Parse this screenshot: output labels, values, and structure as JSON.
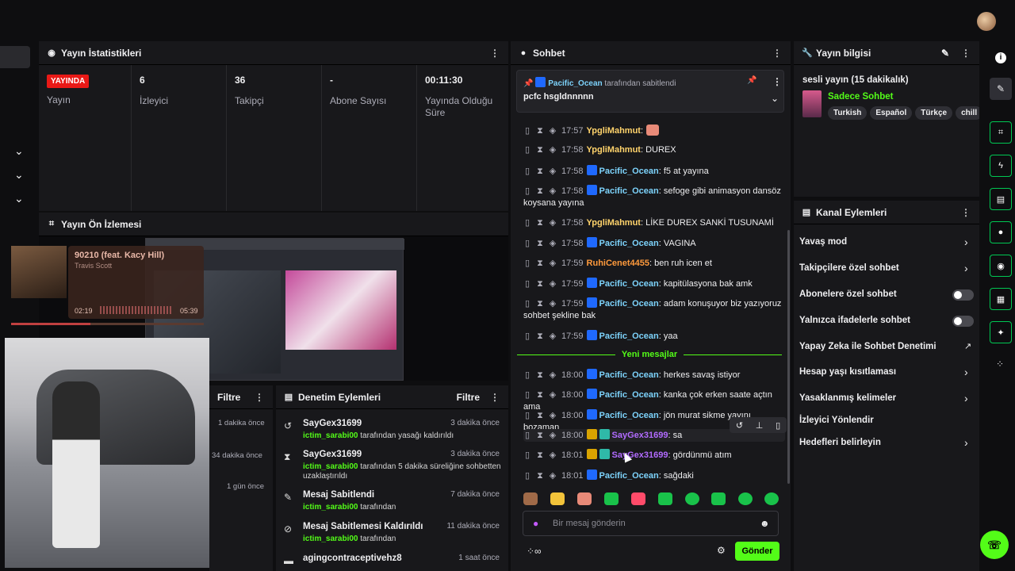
{
  "stats_panel": {
    "title": "Yayın İstatistikleri",
    "live_badge": "YAYINDA",
    "items": [
      {
        "value": "",
        "label": "Yayın"
      },
      {
        "value": "6",
        "label": "İzleyici"
      },
      {
        "value": "36",
        "label": "Takipçi"
      },
      {
        "value": "-",
        "label": "Abone Sayısı"
      },
      {
        "value": "00:11:30",
        "label": "Yayında Olduğu Süre"
      }
    ]
  },
  "preview_panel": {
    "title": "Yayın Ön İzlemesi"
  },
  "music": {
    "title": "90210 (feat. Kacy Hill)",
    "artist": "Travis Scott",
    "elapsed": "02:19",
    "duration": "05:39"
  },
  "left_panel": {
    "filter_label": "Filtre",
    "times": [
      "1 dakika önce",
      "34 dakika önce",
      "1 gün önce"
    ]
  },
  "mod_panel": {
    "title": "Denetim Eylemleri",
    "filter_label": "Filtre",
    "items": [
      {
        "icon": "undo-icon",
        "name": "SayGex31699",
        "time": "3 dakika önce",
        "actor": "ictim_sarabi00",
        "desc": " tarafından yasağı kaldırıldı"
      },
      {
        "icon": "hourglass-icon",
        "name": "SayGex31699",
        "time": "3 dakika önce",
        "actor": "ictim_sarabi00",
        "desc": " tarafından 5 dakika süreliğine sohbetten uzaklaştırıldı"
      },
      {
        "icon": "pin-icon",
        "name": "Mesaj Sabitlendi",
        "time": "7 dakika önce",
        "actor": "ictim_sarabi00",
        "desc": " tarafından"
      },
      {
        "icon": "unpin-icon",
        "name": "Mesaj Sabitlemesi Kaldırıldı",
        "time": "11 dakika önce",
        "actor": "ictim_sarabi00",
        "desc": " tarafından"
      },
      {
        "icon": "chat-icon",
        "name": "agingcontraceptivehz8",
        "time": "1 saat önce",
        "actor": "",
        "desc": ""
      }
    ]
  },
  "chat": {
    "title": "Sohbet",
    "pinned_by_user": "Pacific_Ocean",
    "pinned_by_suffix": "tarafından sabitlendi",
    "pinned_text": "pcfc hsgldnnnnn",
    "new_messages_label": "Yeni mesajlar",
    "messages": [
      {
        "time": "17:57",
        "user": "YpgliMahmut",
        "text": ":",
        "color": "u-yel",
        "badges": []
      },
      {
        "time": "17:58",
        "user": "YpgliMahmut",
        "text": ": DUREX",
        "color": "u-yel",
        "badges": []
      },
      {
        "time": "17:58",
        "user": "Pacific_Ocean",
        "text": ": f5 at yayına",
        "color": "u-blue",
        "badges": [
          "blue"
        ]
      },
      {
        "time": "17:58",
        "user": "Pacific_Ocean",
        "text": ": sefoge gibi animasyon dansöz koysana yayına",
        "color": "u-blue",
        "badges": [
          "blue"
        ]
      },
      {
        "time": "17:58",
        "user": "YpgliMahmut",
        "text": ": LİKE DUREX SANKİ TUSUNAMİ",
        "color": "u-yel",
        "badges": []
      },
      {
        "time": "17:58",
        "user": "Pacific_Ocean",
        "text": ": VAGINA",
        "color": "u-blue",
        "badges": [
          "blue"
        ]
      },
      {
        "time": "17:59",
        "user": "RuhiCenet4455",
        "text": ": ben ruh icen et",
        "color": "u-org",
        "badges": []
      },
      {
        "time": "17:59",
        "user": "Pacific_Ocean",
        "text": ": kapitülasyona bak amk",
        "color": "u-blue",
        "badges": [
          "blue"
        ]
      },
      {
        "time": "17:59",
        "user": "Pacific_Ocean",
        "text": ": adam konuşuyor biz yazıyoruz sohbet şekline bak",
        "color": "u-blue",
        "badges": [
          "blue"
        ]
      },
      {
        "time": "17:59",
        "user": "Pacific_Ocean",
        "text": ": yaa",
        "color": "u-blue",
        "badges": [
          "blue"
        ]
      },
      {
        "time": "18:00",
        "user": "Pacific_Ocean",
        "text": ": herkes savaş istiyor",
        "color": "u-blue",
        "badges": [
          "blue"
        ]
      },
      {
        "time": "18:00",
        "user": "Pacific_Ocean",
        "text": ": kanka çok erken saate açtın ama",
        "color": "u-blue",
        "badges": [
          "blue"
        ]
      },
      {
        "time": "18:00",
        "user": "Pacific_Ocean",
        "text": ": jön murat sikme yayını bozaman",
        "color": "u-blue",
        "badges": [
          "blue"
        ]
      },
      {
        "time": "18:00",
        "user": "SayGex31699",
        "text": ": sa",
        "color": "u-pur",
        "badges": [
          "gold",
          "teal"
        ]
      },
      {
        "time": "18:01",
        "user": "SayGex31699",
        "text": ": gördünmü atım",
        "color": "u-pur",
        "badges": [
          "gold",
          "teal"
        ]
      },
      {
        "time": "18:01",
        "user": "Pacific_Ocean",
        "text": ": sağdaki",
        "color": "u-blue",
        "badges": [
          "blue"
        ]
      }
    ],
    "input_placeholder": "Bir mesaj gönderin",
    "send_label": "Gönder"
  },
  "stream_info": {
    "title": "Yayın bilgisi",
    "stream_title": "sesli yayın (15 dakikalık)",
    "category": "Sadece Sohbet",
    "tags": [
      "Turkish",
      "Español",
      "Türkçe",
      "chill"
    ]
  },
  "channel_actions": {
    "title": "Kanal Eylemleri",
    "items": [
      {
        "label": "Yavaş mod",
        "control": "arrow"
      },
      {
        "label": "Takipçilere özel sohbet",
        "control": "arrow"
      },
      {
        "label": "Abonelere özel sohbet",
        "control": "toggle"
      },
      {
        "label": "Yalnızca ifadelerle sohbet",
        "control": "toggle"
      },
      {
        "label": "Yapay Zeka ile Sohbet Denetimi",
        "control": "external"
      },
      {
        "label": "Hesap yaşı kısıtlaması",
        "control": "arrow"
      },
      {
        "label": "Yasaklanmış kelimeler",
        "control": "arrow"
      },
      {
        "label": "İzleyici Yönlendir",
        "control": "none"
      },
      {
        "label": "Hedefleri belirleyin",
        "control": "arrow"
      }
    ]
  },
  "colors": {
    "accent": "#53fc18",
    "live": "#e91916",
    "panel": "#18181b",
    "bg": "#0e0e10"
  }
}
